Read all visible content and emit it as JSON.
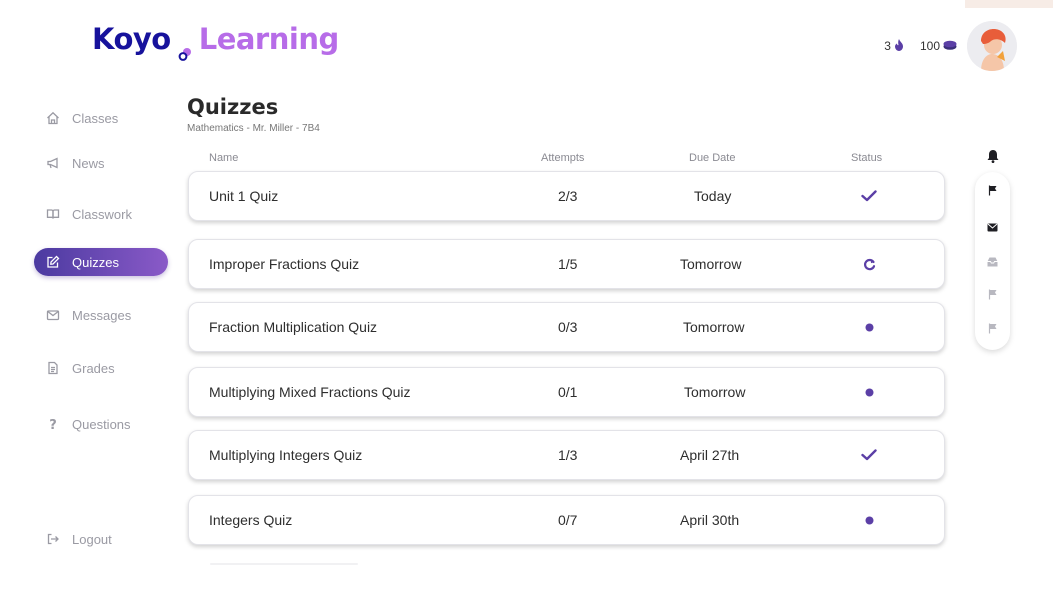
{
  "brand": {
    "part1": "Koyo",
    "part2": "Learning",
    "color1": "#17129c",
    "color2": "#b76ce8"
  },
  "header": {
    "streak_count": "3",
    "streak_icon": "flame-icon",
    "coins_count": "100",
    "coins_icon": "coin-stack-icon",
    "avatar_icon": "avatar-icon"
  },
  "sidebar": {
    "items": [
      {
        "label": "Classes",
        "icon": "home-icon"
      },
      {
        "label": "News",
        "icon": "megaphone-icon"
      },
      {
        "label": "Classwork",
        "icon": "book-icon"
      },
      {
        "label": "Quizzes",
        "icon": "edit-icon",
        "active": true
      },
      {
        "label": "Messages",
        "icon": "envelope-icon"
      },
      {
        "label": "Grades",
        "icon": "document-icon"
      },
      {
        "label": "Questions",
        "icon": "question-icon"
      }
    ],
    "logout": {
      "label": "Logout",
      "icon": "logout-icon"
    }
  },
  "main": {
    "title": "Quizzes",
    "subtitle": "Mathematics - Mr. Miller  - 7B4",
    "columns": {
      "name": "Name",
      "attempts": "Attempts",
      "due": "Due Date",
      "status": "Status"
    },
    "rows": [
      {
        "name": "Unit 1 Quiz",
        "attempts": "2/3",
        "due": "Today",
        "status": "completed"
      },
      {
        "name": "Improper Fractions Quiz",
        "attempts": "1/5",
        "due": "Tomorrow",
        "status": "retry"
      },
      {
        "name": "Fraction Multiplication Quiz",
        "attempts": "0/3",
        "due": "Tomorrow",
        "status": "pending"
      },
      {
        "name": "Multiplying Mixed Fractions Quiz",
        "attempts": "0/1",
        "due": "Tomorrow",
        "status": "pending"
      },
      {
        "name": "Multiplying Integers Quiz",
        "attempts": "1/3",
        "due": "April 27th",
        "status": "completed"
      },
      {
        "name": "Integers Quiz",
        "attempts": "0/7",
        "due": "April 30th",
        "status": "pending"
      }
    ]
  },
  "right_rail": {
    "bell_icon": "bell-icon",
    "items": [
      "flag-icon",
      "envelope-icon",
      "inbox-icon",
      "flag-icon",
      "flag-icon"
    ]
  },
  "colors": {
    "accent": "#5b3fa6",
    "muted_icon": "#9a9aa3"
  }
}
